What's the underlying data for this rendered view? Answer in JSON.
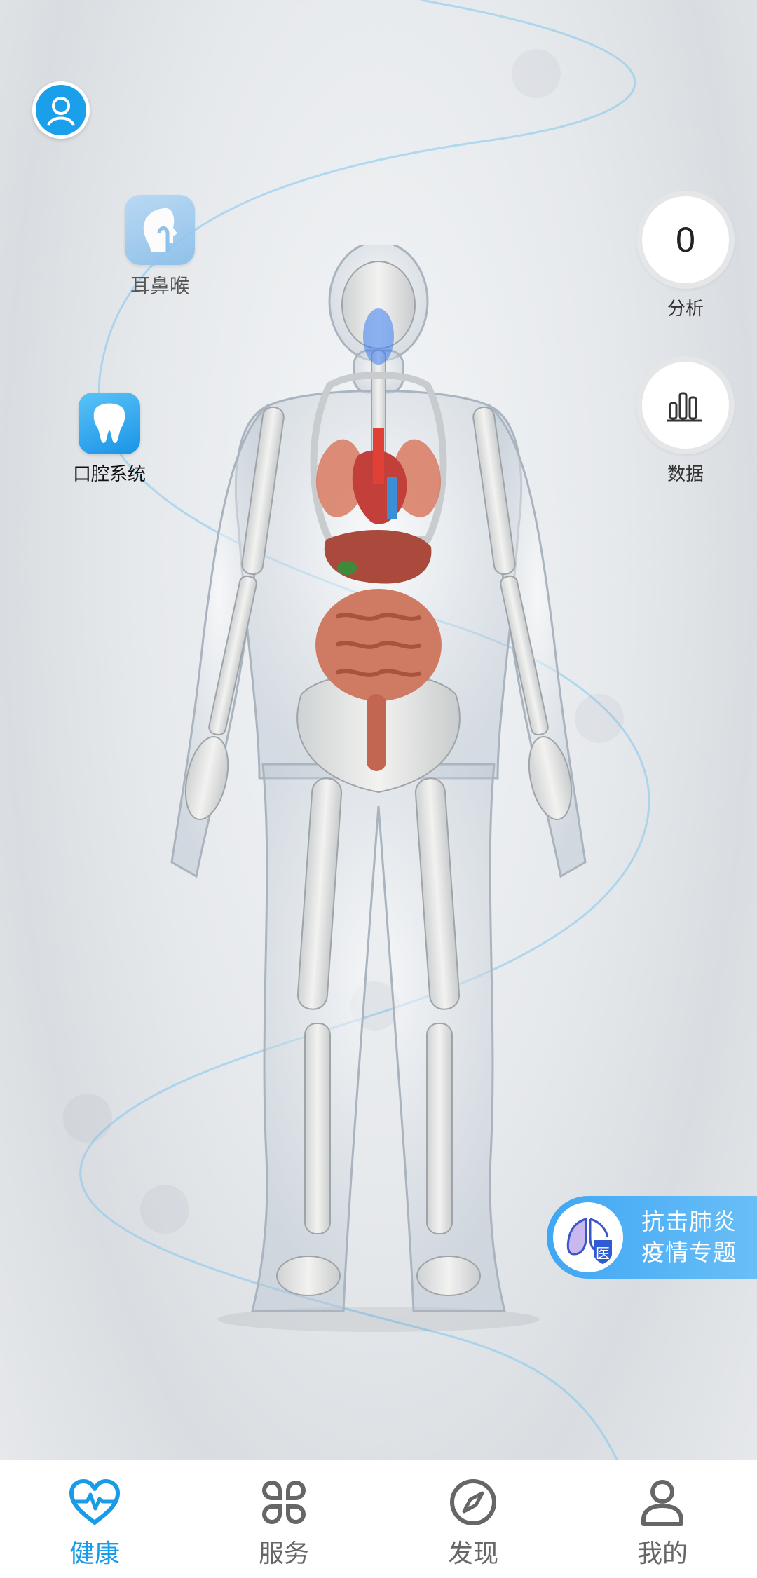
{
  "body_map": {
    "avatar_icon": "user-avatar-icon",
    "systems": [
      {
        "label": "耳鼻喉",
        "icon": "ear-nose-throat-icon"
      },
      {
        "label": "口腔系统",
        "icon": "tooth-icon"
      }
    ]
  },
  "actions": {
    "analysis": {
      "value": "0",
      "label": "分析"
    },
    "data": {
      "label": "数据",
      "icon": "bar-chart-icon"
    }
  },
  "campaign": {
    "line1": "抗击肺炎",
    "line2": "疫情专题",
    "badge": "医",
    "icon": "lungs-shield-icon"
  },
  "tabs": [
    {
      "label": "健康",
      "icon": "heart-pulse-icon",
      "active": true
    },
    {
      "label": "服务",
      "icon": "command-grid-icon",
      "active": false
    },
    {
      "label": "发现",
      "icon": "compass-icon",
      "active": false
    },
    {
      "label": "我的",
      "icon": "person-icon",
      "active": false
    }
  ],
  "colors": {
    "accent": "#1a9be8",
    "tab_inactive": "#666666",
    "campaign_start": "#3fa7f4",
    "campaign_end": "#6cc0f7"
  }
}
